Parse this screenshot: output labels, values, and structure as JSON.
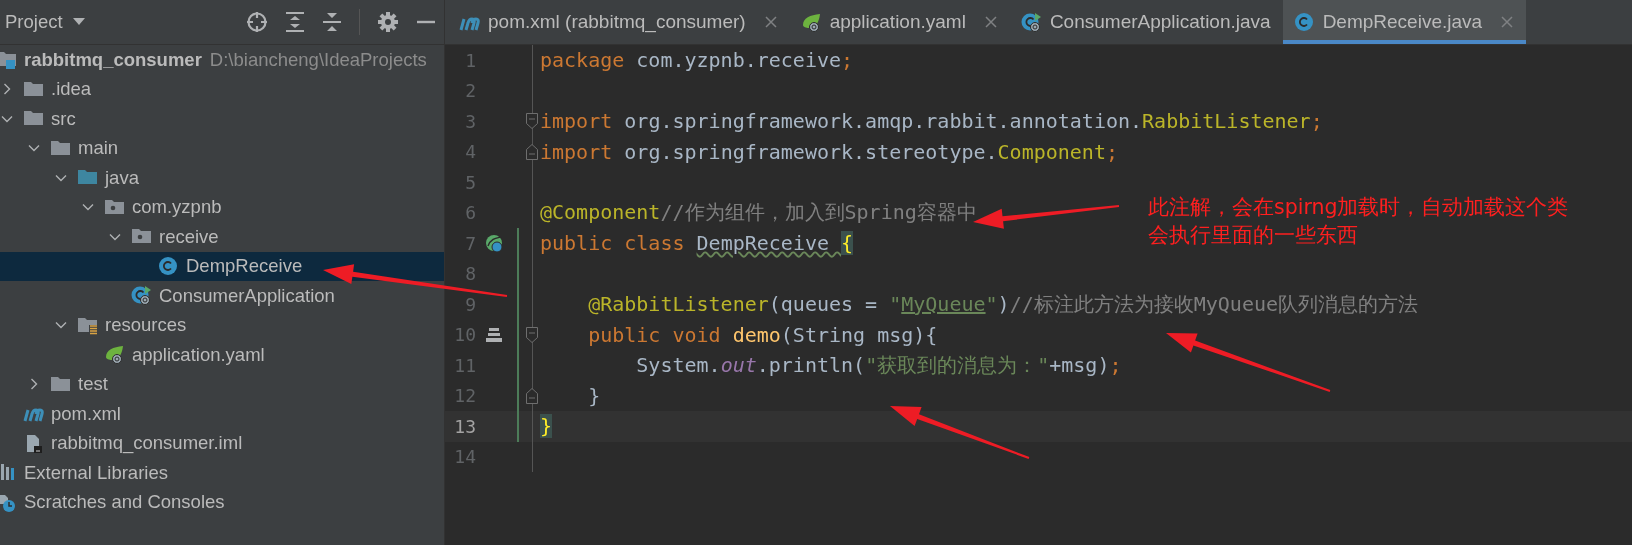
{
  "project_panel": {
    "title": "Project",
    "tree": [
      {
        "label": "rabbitmq_consumer",
        "kind": "module",
        "hint": "D:\\biancheng\\IdeaProjects",
        "selected": false,
        "children": [
          {
            "label": ".idea",
            "kind": "folder",
            "expanded": false,
            "selected": false
          },
          {
            "label": "src",
            "kind": "folder",
            "expanded": true,
            "selected": false,
            "children": [
              {
                "label": "main",
                "kind": "folder",
                "expanded": true,
                "selected": false,
                "children": [
                  {
                    "label": "java",
                    "kind": "source-folder",
                    "expanded": true,
                    "selected": false,
                    "children": [
                      {
                        "label": "com.yzpnb",
                        "kind": "package",
                        "expanded": true,
                        "selected": false,
                        "children": [
                          {
                            "label": "receive",
                            "kind": "package",
                            "expanded": true,
                            "selected": false,
                            "children": [
                              {
                                "label": "DempReceive",
                                "kind": "class",
                                "selected": true
                              }
                            ]
                          },
                          {
                            "label": "ConsumerApplication",
                            "kind": "boot-class",
                            "selected": false
                          }
                        ]
                      }
                    ]
                  },
                  {
                    "label": "resources",
                    "kind": "resources-folder",
                    "expanded": true,
                    "selected": false,
                    "children": [
                      {
                        "label": "application.yaml",
                        "kind": "spring-yaml",
                        "selected": false
                      }
                    ]
                  }
                ]
              },
              {
                "label": "test",
                "kind": "folder",
                "expanded": false,
                "selected": false
              }
            ]
          },
          {
            "label": "pom.xml",
            "kind": "maven",
            "selected": false
          },
          {
            "label": "rabbitmq_consumer.iml",
            "kind": "iml",
            "selected": false
          }
        ]
      },
      {
        "label": "External Libraries",
        "kind": "libraries",
        "selected": false
      },
      {
        "label": "Scratches and Consoles",
        "kind": "scratches",
        "selected": false
      }
    ]
  },
  "tabs": [
    {
      "label": "pom.xml (rabbitmq_consumer)",
      "kind": "maven",
      "selected": false,
      "closable": true
    },
    {
      "label": "application.yaml",
      "kind": "spring-yaml",
      "selected": false,
      "closable": true
    },
    {
      "label": "ConsumerApplication.java",
      "kind": "boot-class",
      "selected": false,
      "closable": false
    },
    {
      "label": "DempReceive.java",
      "kind": "class",
      "selected": true,
      "closable": true
    }
  ],
  "editor": {
    "lines": [
      {
        "number": "1",
        "current": false,
        "changed": false,
        "tokens": [
          {
            "text": "package ",
            "kind": "keyword"
          },
          {
            "text": "com.yzpnb.receive",
            "kind": "plain"
          },
          {
            "text": ";",
            "kind": "keyword"
          }
        ]
      },
      {
        "number": "2",
        "current": false,
        "changed": false
      },
      {
        "number": "3",
        "current": false,
        "changed": false,
        "fold_mark": {
          "kind": "start"
        },
        "tokens": [
          {
            "text": "import ",
            "kind": "keyword"
          },
          {
            "text": "org.springframework.amqp.rabbit.annotation.",
            "kind": "plain"
          },
          {
            "text": "RabbitListener",
            "kind": "annotation"
          },
          {
            "text": ";",
            "kind": "keyword"
          }
        ]
      },
      {
        "number": "4",
        "current": false,
        "changed": false,
        "fold_mark": {
          "kind": "end"
        },
        "tokens": [
          {
            "text": "import ",
            "kind": "keyword"
          },
          {
            "text": "org.springframework.stereotype.",
            "kind": "plain"
          },
          {
            "text": "Component",
            "kind": "annotation"
          },
          {
            "text": ";",
            "kind": "keyword"
          }
        ]
      },
      {
        "number": "5",
        "current": false,
        "changed": false
      },
      {
        "number": "6",
        "current": false,
        "changed": false,
        "tokens": [
          {
            "text": "@Component",
            "kind": "annotation"
          },
          {
            "text": "//作为组件，加入到Spring容器中",
            "kind": "comment"
          }
        ]
      },
      {
        "number": "7",
        "current": false,
        "changed": true,
        "gutter_icon": {
          "kind": "bean"
        },
        "tokens": [
          {
            "text": "public class ",
            "kind": "keyword"
          },
          {
            "text": "DempReceive ",
            "kind": "warning"
          },
          {
            "text": "{",
            "kind": "brace"
          }
        ]
      },
      {
        "number": "8",
        "current": false,
        "changed": true
      },
      {
        "number": "9",
        "current": false,
        "changed": true,
        "tokens": [
          {
            "text": "    @RabbitListener",
            "kind": "annotation"
          },
          {
            "text": "(queues = ",
            "kind": "plain"
          },
          {
            "text": "\"",
            "kind": "string"
          },
          {
            "text": "MyQueue",
            "kind": "link"
          },
          {
            "text": "\"",
            "kind": "string"
          },
          {
            "text": ")",
            "kind": "plain"
          },
          {
            "text": "//标注此方法为接收MyQueue队列消息的方法",
            "kind": "comment"
          }
        ]
      },
      {
        "number": "10",
        "current": false,
        "changed": true,
        "gutter_icon": {
          "kind": "implement"
        },
        "fold_mark": {
          "kind": "start"
        },
        "tokens": [
          {
            "text": "    public void ",
            "kind": "keyword"
          },
          {
            "text": "demo",
            "kind": "method"
          },
          {
            "text": "(String msg){",
            "kind": "plain"
          }
        ]
      },
      {
        "number": "11",
        "current": false,
        "changed": true,
        "tokens": [
          {
            "text": "        System.",
            "kind": "plain"
          },
          {
            "text": "out",
            "kind": "field"
          },
          {
            "text": ".println(",
            "kind": "plain"
          },
          {
            "text": "\"获取到的消息为：\"",
            "kind": "string"
          },
          {
            "text": "+msg)",
            "kind": "plain"
          },
          {
            "text": ";",
            "kind": "keyword"
          }
        ]
      },
      {
        "number": "12",
        "current": false,
        "changed": true,
        "fold_mark": {
          "kind": "end"
        },
        "tokens": [
          {
            "text": "    }",
            "kind": "plain"
          }
        ]
      },
      {
        "number": "13",
        "current": true,
        "changed": true,
        "tokens": [
          {
            "text": "}",
            "kind": "brace"
          }
        ]
      },
      {
        "number": "14",
        "current": false,
        "changed": false
      }
    ]
  },
  "annotation": {
    "lines": [
      "此注解，会在spirng加载时，自动加载这个类",
      "会执行里面的一些东西"
    ]
  }
}
